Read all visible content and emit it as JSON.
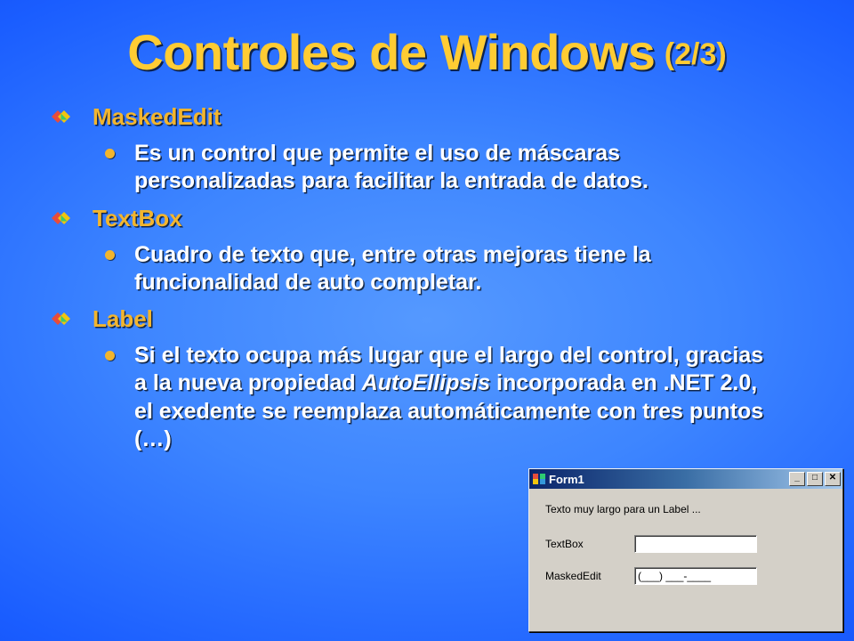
{
  "title": "Controles de Windows",
  "pager": "(2/3)",
  "items": [
    {
      "heading": "MaskedEdit",
      "desc": "Es un control que permite el uso de máscaras personalizadas para facilitar la entrada de datos."
    },
    {
      "heading": "TextBox",
      "desc": "Cuadro de texto que, entre otras mejoras tiene la funcionalidad de auto completar."
    },
    {
      "heading": "Label",
      "desc_pre": "Si el texto ocupa más lugar que el largo del control, gracias a la nueva propiedad ",
      "desc_em": "AutoEllipsis",
      "desc_post": " incorporada en .NET 2.0, el exedente se reemplaza automáticamente con tres puntos (…)"
    }
  ],
  "form": {
    "title": "Form1",
    "long_label": "Texto muy largo para un Label ...",
    "textbox_label": "TextBox",
    "textbox_value": "",
    "masked_label": "MaskedEdit",
    "masked_value": "(___) ___-____"
  }
}
